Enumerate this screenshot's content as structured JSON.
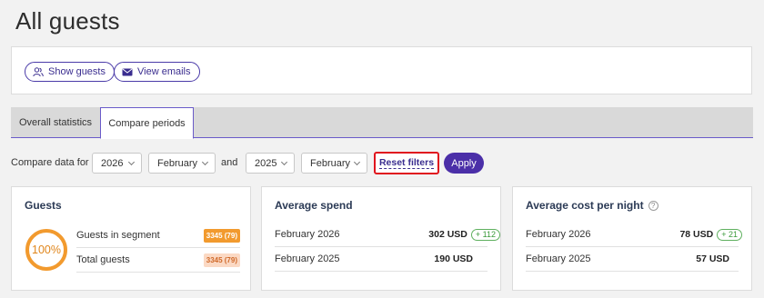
{
  "page": {
    "title": "All guests"
  },
  "actions": {
    "show_guests": {
      "label": "Show guests",
      "icon": "users-icon"
    },
    "view_emails": {
      "label": "View emails",
      "icon": "envelope-icon"
    }
  },
  "tabs": [
    {
      "label": "Overall statistics",
      "active": false
    },
    {
      "label": "Compare periods",
      "active": true
    }
  ],
  "filters": {
    "compare_label": "Compare data for",
    "and_label": "and",
    "period1": {
      "year": "2026",
      "month": "February"
    },
    "period2": {
      "year": "2025",
      "month": "February"
    },
    "reset_label": "Reset filters",
    "apply_label": "Apply"
  },
  "cards": {
    "guests": {
      "title": "Guests",
      "percent": "100%",
      "rows": [
        {
          "label": "Guests in segment",
          "value": "3345 (79)"
        },
        {
          "label": "Total guests",
          "value": "3345 (79)"
        }
      ]
    },
    "spend": {
      "title": "Average spend",
      "rows": [
        {
          "label": "February 2026",
          "value": "302 USD",
          "delta": "+ 112"
        },
        {
          "label": "February 2025",
          "value": "190 USD"
        }
      ]
    },
    "cost": {
      "title": "Average cost per night",
      "help": "?",
      "rows": [
        {
          "label": "February 2026",
          "value": "78 USD",
          "delta": "+ 21"
        },
        {
          "label": "February 2025",
          "value": "57 USD"
        }
      ]
    }
  },
  "colors": {
    "accent": "#4b2fa8",
    "highlight": "#e0141e",
    "orange": "#f29a2e",
    "positive": "#3a9a3a"
  }
}
